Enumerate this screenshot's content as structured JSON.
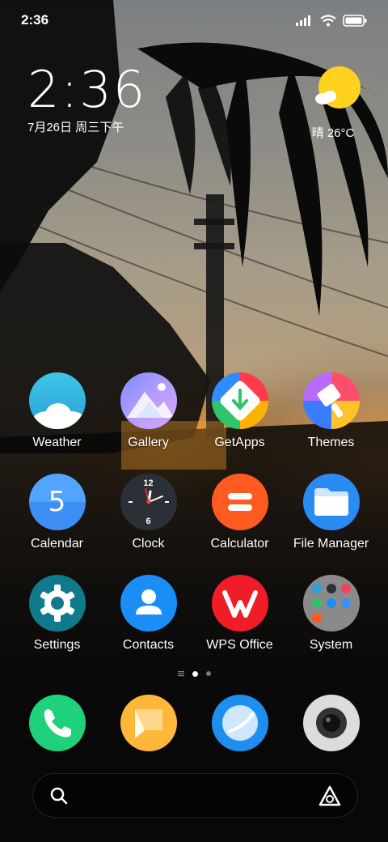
{
  "status_bar": {
    "time": "2:36"
  },
  "clock_widget": {
    "time": "2:36",
    "date": "7月26日 周三下午"
  },
  "weather_widget": {
    "condition": "晴 26°C",
    "icon": "sun-cloud-icon"
  },
  "apps": {
    "row1": [
      {
        "label": "Weather",
        "icon": "weather-icon"
      },
      {
        "label": "Gallery",
        "icon": "gallery-icon"
      },
      {
        "label": "GetApps",
        "icon": "getapps-icon"
      },
      {
        "label": "Themes",
        "icon": "themes-icon"
      }
    ],
    "row2": [
      {
        "label": "Calendar",
        "icon": "calendar-icon",
        "badge": "5"
      },
      {
        "label": "Clock",
        "icon": "clock-icon",
        "top_numeral": "12",
        "bottom_numeral": "6"
      },
      {
        "label": "Calculator",
        "icon": "calculator-icon"
      },
      {
        "label": "File Manager",
        "icon": "folder-icon"
      }
    ],
    "row3": [
      {
        "label": "Settings",
        "icon": "settings-gear-icon"
      },
      {
        "label": "Contacts",
        "icon": "contacts-icon"
      },
      {
        "label": "WPS Office",
        "icon": "wps-office-icon"
      },
      {
        "label": "System",
        "icon": "system-folder-icon"
      }
    ]
  },
  "dock": [
    {
      "icon": "phone-icon"
    },
    {
      "icon": "messages-icon"
    },
    {
      "icon": "browser-icon"
    },
    {
      "icon": "camera-icon"
    }
  ],
  "page_indicator": {
    "current_page": 1,
    "total_pages": 2
  },
  "search_bar": {
    "left_icon": "search-icon",
    "right_icon": "assistant-icon"
  },
  "colors": {
    "weather": "#3fb5e0",
    "calendar": "#3d8ff5",
    "clock": "#2b2f36",
    "calculator": "#ff5a1f",
    "file_manager": "#2a8cf2",
    "settings": "#107a8c",
    "contacts": "#1a8ef5",
    "wps": "#f01d28",
    "phone": "#1fd17a",
    "messages": "#ffb739",
    "browser": "#1e8ff0",
    "camera": "#dcdcdc"
  }
}
